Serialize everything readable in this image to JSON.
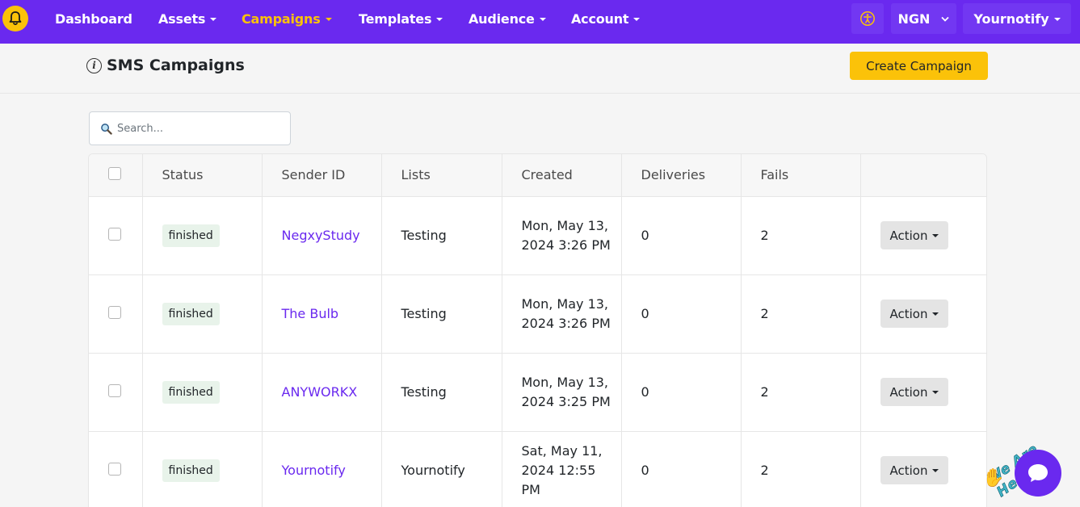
{
  "nav": {
    "items": [
      {
        "label": "Dashboard",
        "dropdown": false,
        "active": false
      },
      {
        "label": "Assets",
        "dropdown": true,
        "active": false
      },
      {
        "label": "Campaigns",
        "dropdown": true,
        "active": true
      },
      {
        "label": "Templates",
        "dropdown": true,
        "active": false
      },
      {
        "label": "Audience",
        "dropdown": true,
        "active": false
      },
      {
        "label": "Account",
        "dropdown": true,
        "active": false
      }
    ],
    "currency": "NGN",
    "account_label": "Yournotify",
    "logo_icon": "bell-icon",
    "accessibility_icon": "accessibility-icon"
  },
  "page": {
    "title": "SMS Campaigns",
    "create_button": "Create Campaign"
  },
  "search": {
    "placeholder": "Search..."
  },
  "table": {
    "columns": [
      "Status",
      "Sender ID",
      "Lists",
      "Created",
      "Deliveries",
      "Fails"
    ],
    "rows": [
      {
        "status": "finished",
        "sender": "NegxyStudy",
        "list": "Testing",
        "created": "Mon, May 13, 2024 3:26 PM",
        "deliveries": "0",
        "fails": "2",
        "action": "Action"
      },
      {
        "status": "finished",
        "sender": "The Bulb",
        "list": "Testing",
        "created": "Mon, May 13, 2024 3:26 PM",
        "deliveries": "0",
        "fails": "2",
        "action": "Action"
      },
      {
        "status": "finished",
        "sender": "ANYWORKX",
        "list": "Testing",
        "created": "Mon, May 13, 2024 3:25 PM",
        "deliveries": "0",
        "fails": "2",
        "action": "Action"
      },
      {
        "status": "finished",
        "sender": "Yournotify",
        "list": "Yournotify",
        "created": "Sat, May 11, 2024 12:55 PM",
        "deliveries": "0",
        "fails": "2",
        "action": "Action"
      }
    ]
  },
  "chat": {
    "tagline": "We Are Here!"
  },
  "colors": {
    "brand_purple": "#6a29ef",
    "accent_yellow": "#fbc209",
    "status_badge_bg": "#e8f3ea"
  }
}
